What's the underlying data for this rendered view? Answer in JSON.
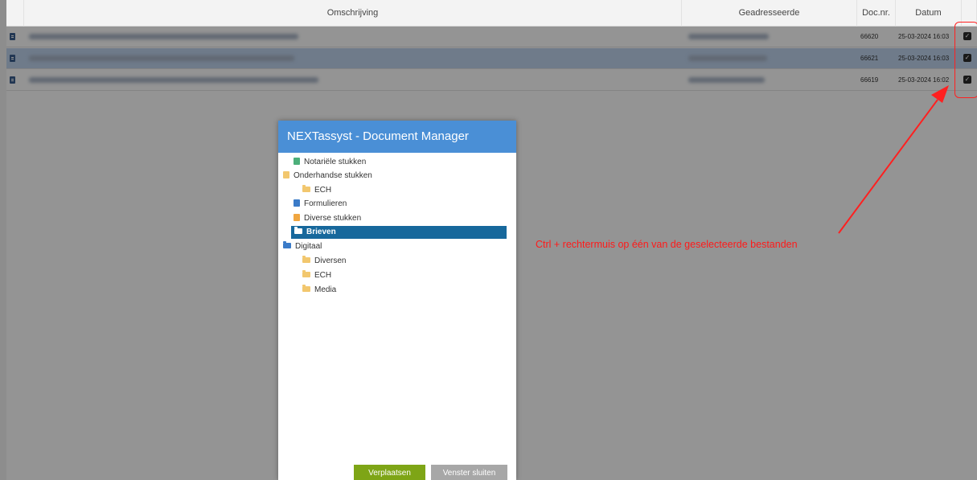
{
  "table": {
    "columns": {
      "description": "Omschrijving",
      "addressee": "Geadresseerde",
      "docnr": "Doc.nr.",
      "date": "Datum"
    },
    "rows": [
      {
        "docnr": "66620",
        "date": "25-03-2024 16:03",
        "checked": true,
        "selected": false
      },
      {
        "docnr": "66621",
        "date": "25-03-2024 16:03",
        "checked": true,
        "selected": true
      },
      {
        "docnr": "66619",
        "date": "25-03-2024 16:02",
        "checked": true,
        "selected": false
      }
    ]
  },
  "dialog": {
    "title": "NEXTassyst - Document Manager",
    "tree": [
      {
        "label": "Notariële stukken",
        "icon": "file-green-icon",
        "level": 1
      },
      {
        "label": "Onderhandse stukken",
        "icon": "file-yellow-icon",
        "level": 0
      },
      {
        "label": "ECH",
        "icon": "folder-yellow-icon",
        "level": 2
      },
      {
        "label": "Formulieren",
        "icon": "file-blue-icon",
        "level": 1
      },
      {
        "label": "Diverse stukken",
        "icon": "file-orange-icon",
        "level": 1
      },
      {
        "label": "Brieven",
        "icon": "folder-white-icon",
        "level": 1,
        "selected": true
      },
      {
        "label": "Digitaal",
        "icon": "folder-blue-icon",
        "level": 0
      },
      {
        "label": "Diversen",
        "icon": "folder-yellow-icon",
        "level": 2
      },
      {
        "label": "ECH",
        "icon": "folder-yellow-icon",
        "level": 2
      },
      {
        "label": "Media",
        "icon": "folder-yellow-icon",
        "level": 2
      }
    ],
    "buttons": {
      "move": "Verplaatsen",
      "close": "Venster sluiten"
    }
  },
  "annotation": {
    "text": "Ctrl + rechtermuis op één van de geselecteerde bestanden",
    "color": "#ff1a1a"
  },
  "colors": {
    "dialog_header": "#4a8fd6",
    "selected_tree_item": "#17689c",
    "move_button": "#7ea516",
    "close_button": "#a7a7a7"
  }
}
